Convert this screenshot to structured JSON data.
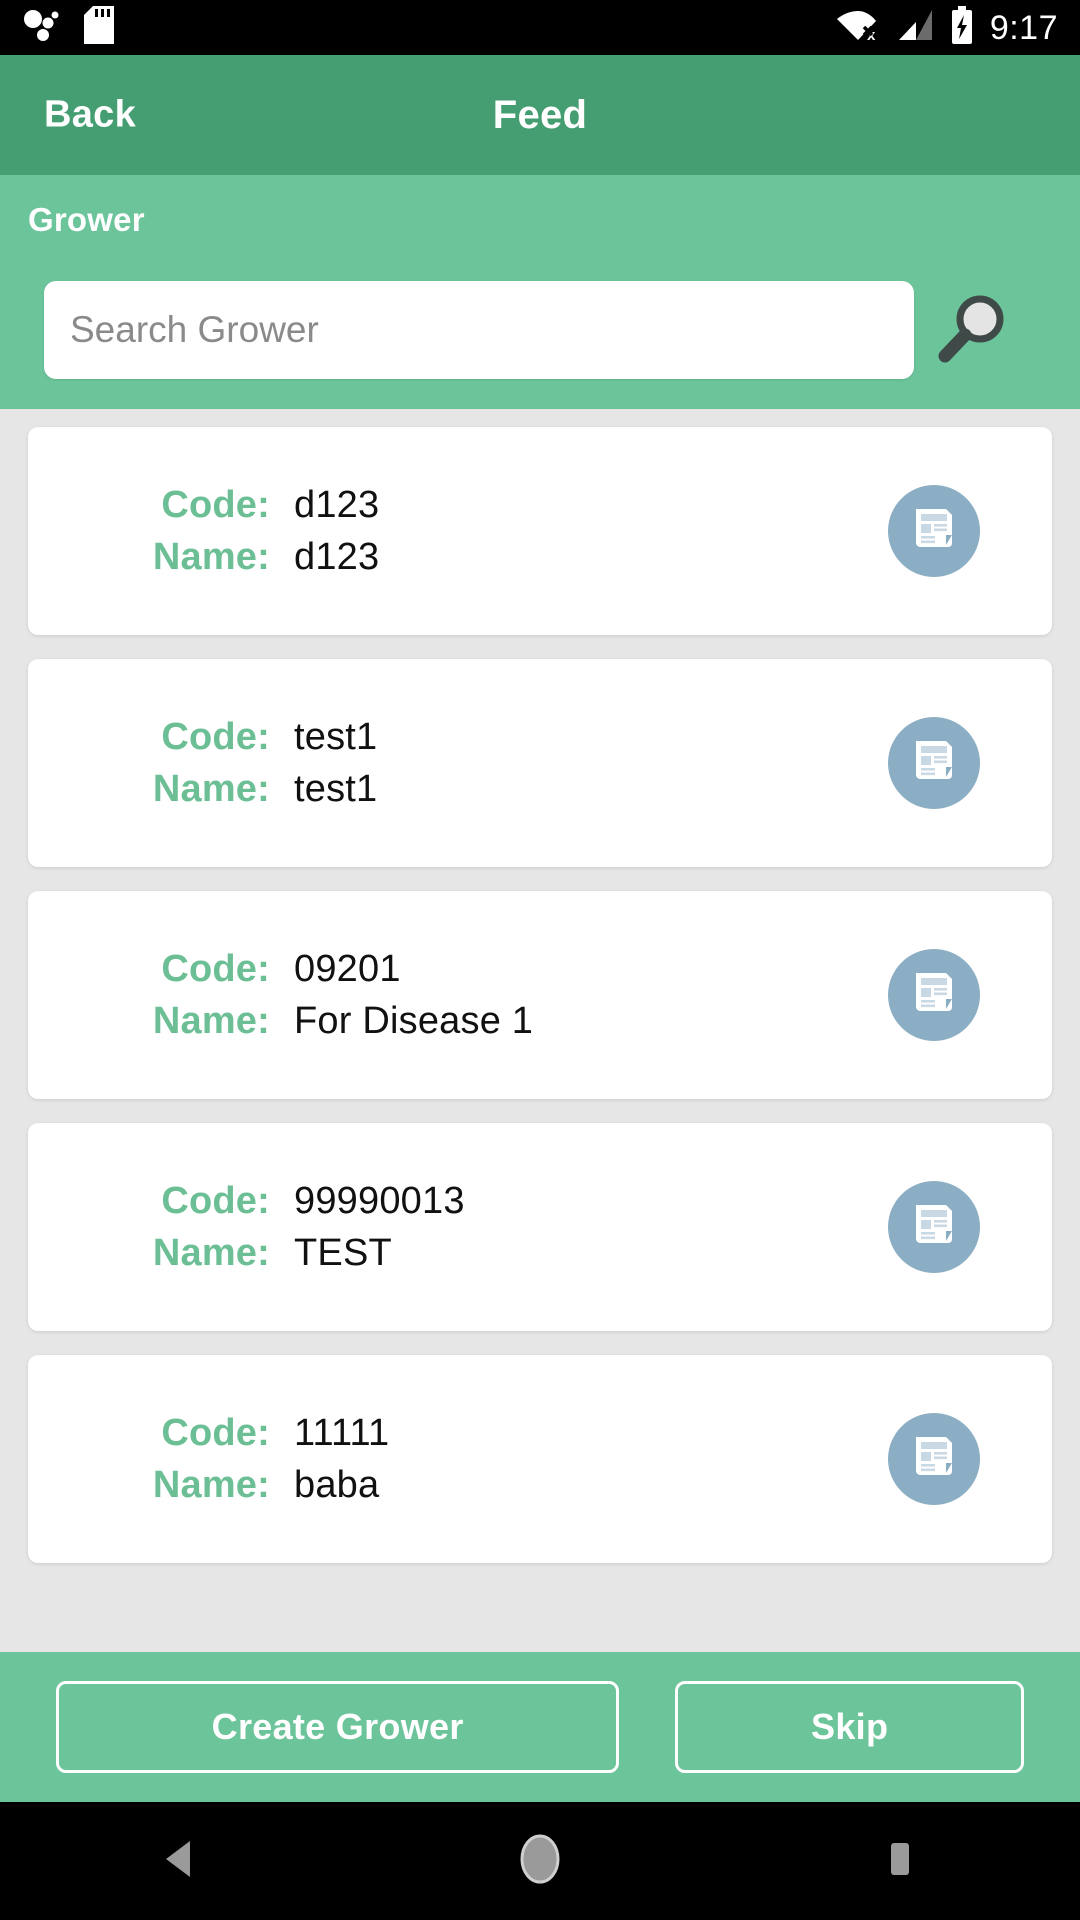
{
  "status_bar": {
    "time": "9:17",
    "left_icons": [
      "bubbles-icon",
      "sd-card-icon"
    ],
    "right_icons": [
      "wifi-off-icon",
      "cellular-signal-icon",
      "battery-charging-icon"
    ]
  },
  "app_bar": {
    "back_label": "Back",
    "title": "Feed",
    "background_color": "#459E72"
  },
  "search_panel": {
    "section_label": "Grower",
    "search_value": "",
    "search_placeholder": "Search Grower",
    "search_icon": "magnifier-icon",
    "background_color": "#6CC49A"
  },
  "list": {
    "code_label": "Code:",
    "name_label": "Name:",
    "row_icon": "document-icon",
    "icon_circle_color": "#8BAEC4",
    "label_color": "#6CBF95",
    "items": [
      {
        "code": "d123",
        "name": "d123"
      },
      {
        "code": "test1",
        "name": "test1"
      },
      {
        "code": "09201",
        "name": "For Disease 1"
      },
      {
        "code": "99990013",
        "name": "TEST"
      },
      {
        "code": "11111",
        "name": "baba"
      }
    ]
  },
  "action_bar": {
    "create_label": "Create Grower",
    "skip_label": "Skip"
  },
  "nav_bar": {
    "back_icon": "triangle-back-icon",
    "home_icon": "circle-home-icon",
    "recents_icon": "square-recents-icon"
  }
}
